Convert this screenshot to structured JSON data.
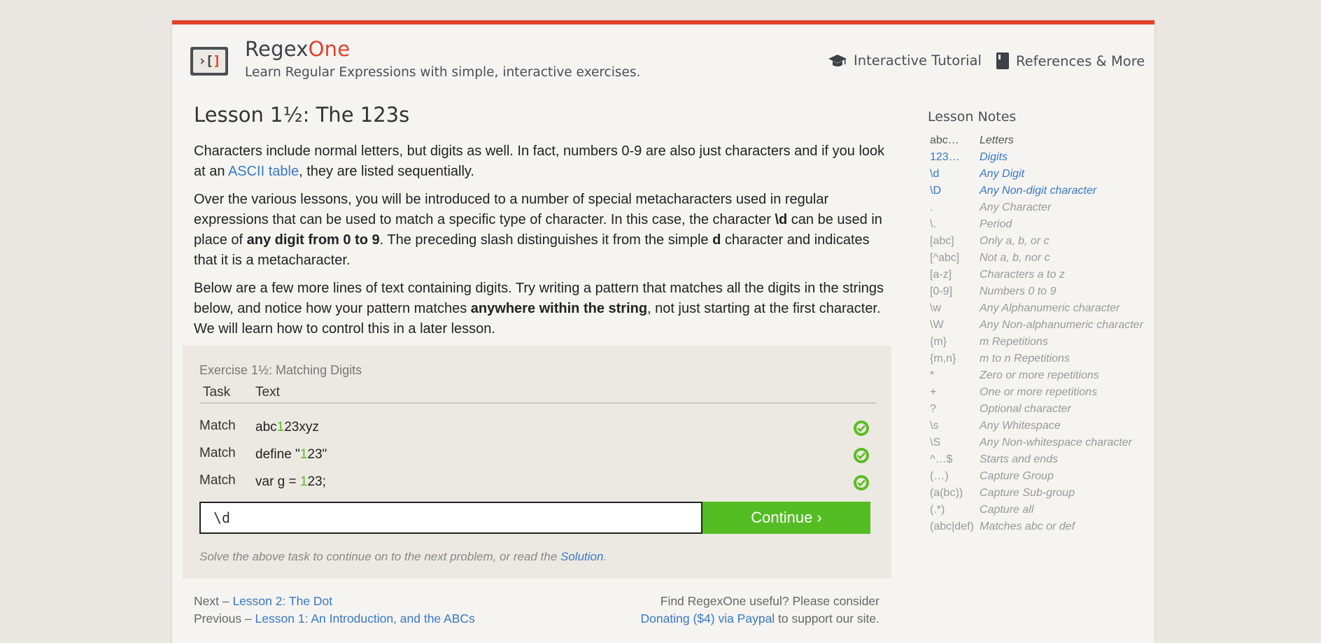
{
  "header": {
    "logo_text": "›[]",
    "brand_regex": "Regex",
    "brand_one": "One",
    "tagline": "Learn Regular Expressions with simple, interactive exercises.",
    "nav": [
      {
        "label": "Interactive Tutorial",
        "icon": "graduation-cap-icon"
      },
      {
        "label": "References & More",
        "icon": "book-icon"
      }
    ]
  },
  "lesson": {
    "title": "Lesson 1½: The 123s",
    "p1_a": "Characters include normal letters, but digits as well. In fact, numbers 0-9 are also just characters and if you look at an ",
    "p1_link": "ASCII table",
    "p1_b": ", they are listed sequentially.",
    "p2_a": "Over the various lessons, you will be introduced to a number of special metacharacters used in regular expressions that can be used to match a specific type of character. In this case, the character ",
    "p2_b1": "\\d",
    "p2_c": " can be used in place of ",
    "p2_b2": "any digit from 0 to 9",
    "p2_d": ". The preceding slash distinguishes it from the simple ",
    "p2_b3": "d",
    "p2_e": " character and indicates that it is a metacharacter.",
    "p3_a": "Below are a few more lines of text containing digits. Try writing a pattern that matches all the digits in the strings below, and notice how your pattern matches ",
    "p3_b": "anywhere within the string",
    "p3_c": ", not just starting at the first character. We will learn how to control this in a later lesson."
  },
  "exercise": {
    "title": "Exercise 1½: Matching Digits",
    "col_task": "Task",
    "col_text": "Text",
    "rows": [
      {
        "task": "Match",
        "pre": "abc",
        "hl": "1",
        "post": "23xyz",
        "status": "passed"
      },
      {
        "task": "Match",
        "pre": "define \"",
        "hl": "1",
        "post": "23\"",
        "status": "passed"
      },
      {
        "task": "Match",
        "pre": "var g = ",
        "hl": "1",
        "post": "23;",
        "status": "passed"
      }
    ],
    "input_value": "\\d",
    "continue_label": "Continue ›",
    "footer_text": "Solve the above task to continue on to the next problem, or read the ",
    "footer_link": "Solution",
    "footer_end": ".",
    "accent_color": "#53bd23"
  },
  "bottom": {
    "next_prefix": "Next – ",
    "next_link": "Lesson 2: The Dot",
    "prev_prefix": "Previous – ",
    "prev_link": "Lesson 1: An Introduction, and the ABCs",
    "donate_line1": "Find RegexOne useful? Please consider",
    "donate_link": "Donating ($4) via Paypal",
    "donate_end": " to support our site."
  },
  "notes": {
    "title": "Lesson Notes",
    "items": [
      {
        "k": "abc…",
        "v": "Letters",
        "state": "dark"
      },
      {
        "k": "123…",
        "v": "Digits",
        "state": "active"
      },
      {
        "k": "\\d",
        "v": "Any Digit",
        "state": "active"
      },
      {
        "k": "\\D",
        "v": "Any Non-digit character",
        "state": "active"
      },
      {
        "k": ".",
        "v": "Any Character",
        "state": ""
      },
      {
        "k": "\\.",
        "v": "Period",
        "state": ""
      },
      {
        "k": "[abc]",
        "v": "Only a, b, or c",
        "state": ""
      },
      {
        "k": "[^abc]",
        "v": "Not a, b, nor c",
        "state": ""
      },
      {
        "k": "[a-z]",
        "v": "Characters a to z",
        "state": ""
      },
      {
        "k": "[0-9]",
        "v": "Numbers 0 to 9",
        "state": ""
      },
      {
        "k": "\\w",
        "v": "Any Alphanumeric character",
        "state": ""
      },
      {
        "k": "\\W",
        "v": "Any Non-alphanumeric character",
        "state": ""
      },
      {
        "k": "{m}",
        "v": "m Repetitions",
        "state": ""
      },
      {
        "k": "{m,n}",
        "v": "m to n Repetitions",
        "state": ""
      },
      {
        "k": "*",
        "v": "Zero or more repetitions",
        "state": ""
      },
      {
        "k": "+",
        "v": "One or more repetitions",
        "state": ""
      },
      {
        "k": "?",
        "v": "Optional character",
        "state": ""
      },
      {
        "k": "\\s",
        "v": "Any Whitespace",
        "state": ""
      },
      {
        "k": "\\S",
        "v": "Any Non-whitespace character",
        "state": ""
      },
      {
        "k": "^…$",
        "v": "Starts and ends",
        "state": ""
      },
      {
        "k": "(…)",
        "v": "Capture Group",
        "state": ""
      },
      {
        "k": "(a(bc))",
        "v": "Capture Sub-group",
        "state": ""
      },
      {
        "k": "(.*)",
        "v": "Capture all",
        "state": ""
      },
      {
        "k": "(abc|def)",
        "v": "Matches abc or def",
        "state": ""
      }
    ]
  }
}
